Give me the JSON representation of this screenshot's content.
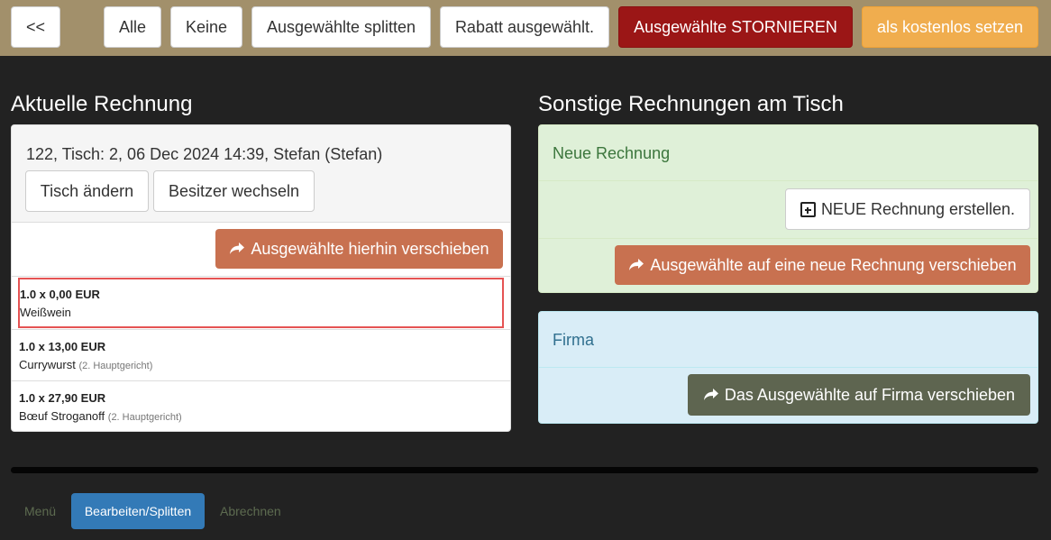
{
  "toolbar": {
    "back": "<<",
    "all": "Alle",
    "none": "Keine",
    "split": "Ausgewählte splitten",
    "discount": "Rabatt ausgewählt.",
    "cancel": "Ausgewählte STORNIEREN",
    "free": "als kostenlos setzen"
  },
  "current_invoice": {
    "title": "Aktuelle Rechnung",
    "header": "122, Tisch: 2, 06 Dec 2024 14:39, Stefan (Stefan)",
    "change_table": "Tisch ändern",
    "change_owner": "Besitzer wechseln",
    "move_here": "Ausgewählte hierhin verschieben",
    "items": [
      {
        "qty": "1.0 x 0,00 EUR",
        "name": "Weißwein",
        "tag": "",
        "selected": true
      },
      {
        "qty": "1.0 x 13,00 EUR",
        "name": "Currywurst",
        "tag": "(2. Hauptgericht)",
        "selected": false
      },
      {
        "qty": "1.0 x 27,90 EUR",
        "name": "Bœuf Stroganoff",
        "tag": "(2. Hauptgericht)",
        "selected": false
      }
    ]
  },
  "other_invoices": {
    "title": "Sonstige Rechnungen am Tisch",
    "new_invoice": {
      "heading": "Neue Rechnung",
      "create": "NEUE Rechnung erstellen.",
      "move": "Ausgewählte auf eine neue Rechnung verschieben"
    },
    "company": {
      "heading": "Firma",
      "move": "Das Ausgewählte auf Firma verschieben"
    }
  },
  "bottom_nav": {
    "menu": "Menü",
    "edit": "Bearbeiten/Splitten",
    "checkout": "Abrechnen"
  },
  "colors": {
    "topbar": "#a2906b",
    "danger": "#9b1616",
    "warning": "#f0ad4e",
    "move": "#c87150",
    "company": "#5e6550",
    "active_tab": "#337ab7"
  },
  "icons": [
    "share-icon",
    "plus-square-icon"
  ]
}
